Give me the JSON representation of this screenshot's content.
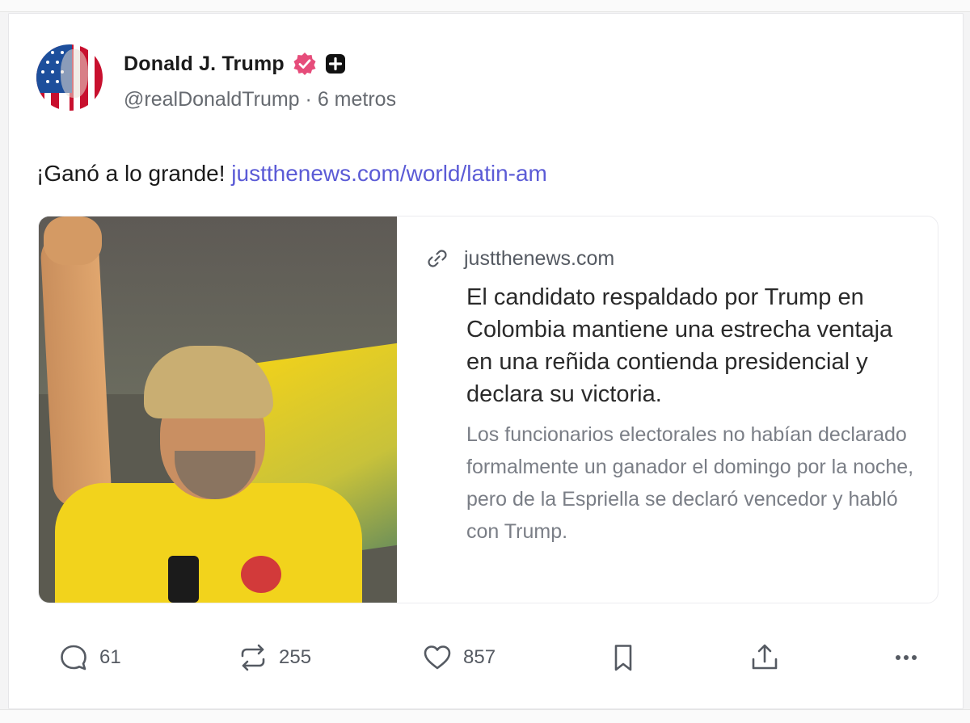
{
  "author": {
    "display_name": "Donald J. Trump",
    "handle": "@realDonaldTrump",
    "separator": " · ",
    "time_ago": "6 metros"
  },
  "post": {
    "text": "¡Ganó a lo grande! ",
    "link_text": "justthenews.com/world/latin-am"
  },
  "link_preview": {
    "domain": "justthenews.com",
    "headline": "El candidato respaldado por Trump en Colombia mantiene una estrecha ventaja en una reñida contienda presidencial y declara su victoria.",
    "description": "Los funcionarios electorales no habían declarado formalmente un ganador el domingo por la noche, pero de la Espriella se declaró vencedor y habló con Trump."
  },
  "actions": {
    "replies": "61",
    "reposts": "255",
    "likes": "857"
  },
  "icons": {
    "verified": "verified-badge-icon",
    "plus": "plus-badge-icon",
    "link": "link-icon",
    "reply": "reply-icon",
    "repost": "repost-icon",
    "like": "heart-icon",
    "bookmark": "bookmark-icon",
    "share": "share-icon",
    "more": "more-icon"
  },
  "colors": {
    "link": "#5b5bd6",
    "verified": "#e64c7a",
    "muted_text": "#666a70"
  }
}
